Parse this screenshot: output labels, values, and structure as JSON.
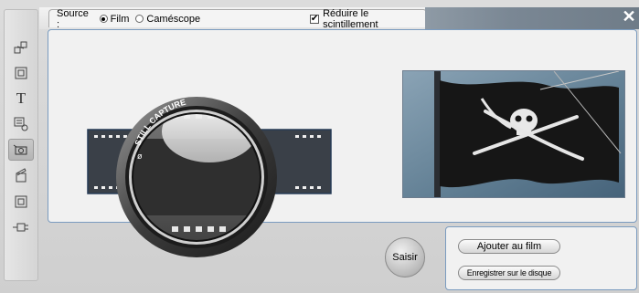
{
  "topbar": {
    "source_label": "Source :",
    "source_options": [
      {
        "label": "Film",
        "selected": true
      },
      {
        "label": "Caméscope",
        "selected": false
      }
    ],
    "flicker_checkbox": {
      "label": "Réduire le scintillement",
      "checked": true
    },
    "close_symbol": "✕"
  },
  "toolbar": {
    "items": [
      {
        "name": "transitions",
        "icon": "transitions-icon"
      },
      {
        "name": "titles-editor",
        "icon": "frame-icon"
      },
      {
        "name": "text",
        "icon": "text-icon",
        "glyph": "T"
      },
      {
        "name": "audio",
        "icon": "audio-list-icon"
      },
      {
        "name": "frame-grab",
        "icon": "camera-grab-icon",
        "active": true
      },
      {
        "name": "clapper",
        "icon": "clapper-icon"
      },
      {
        "name": "menu",
        "icon": "square-button-icon"
      },
      {
        "name": "plugin",
        "icon": "plug-icon"
      }
    ]
  },
  "capture": {
    "lens_text": "STILL CAPTURE",
    "lens_symbol": "ø",
    "grab_button_label": "Saisir"
  },
  "actions": {
    "add_to_movie_label": "Ajouter au film",
    "save_to_disk_label": "Enregistrer sur le disque"
  },
  "colors": {
    "panel_border": "#7a9bbf",
    "title_bar": "#7a8794"
  }
}
